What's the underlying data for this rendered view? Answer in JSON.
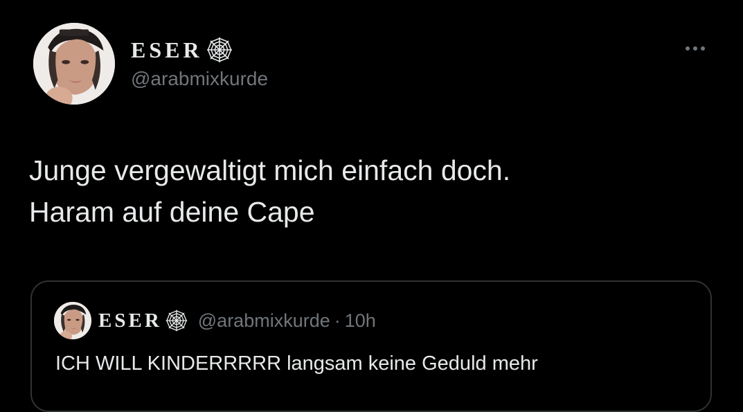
{
  "tweet": {
    "display_name": "ESER",
    "name_icon": "spider-web-icon",
    "handle": "@arabmixkurde",
    "more_icon": "more-options-icon",
    "text": "Junge vergewaltigt mich einfach doch.\nHaram auf deine Cape"
  },
  "quoted_tweet": {
    "display_name": "ESER",
    "name_icon": "spider-web-icon",
    "handle": "@arabmixkurde",
    "separator": "·",
    "time": "10h",
    "text": "ICH WILL KINDERRRRR langsam keine Geduld mehr"
  },
  "colors": {
    "background": "#000000",
    "primary_text": "#e7e9ea",
    "secondary_text": "#71767b",
    "card_border": "#2f3336"
  }
}
